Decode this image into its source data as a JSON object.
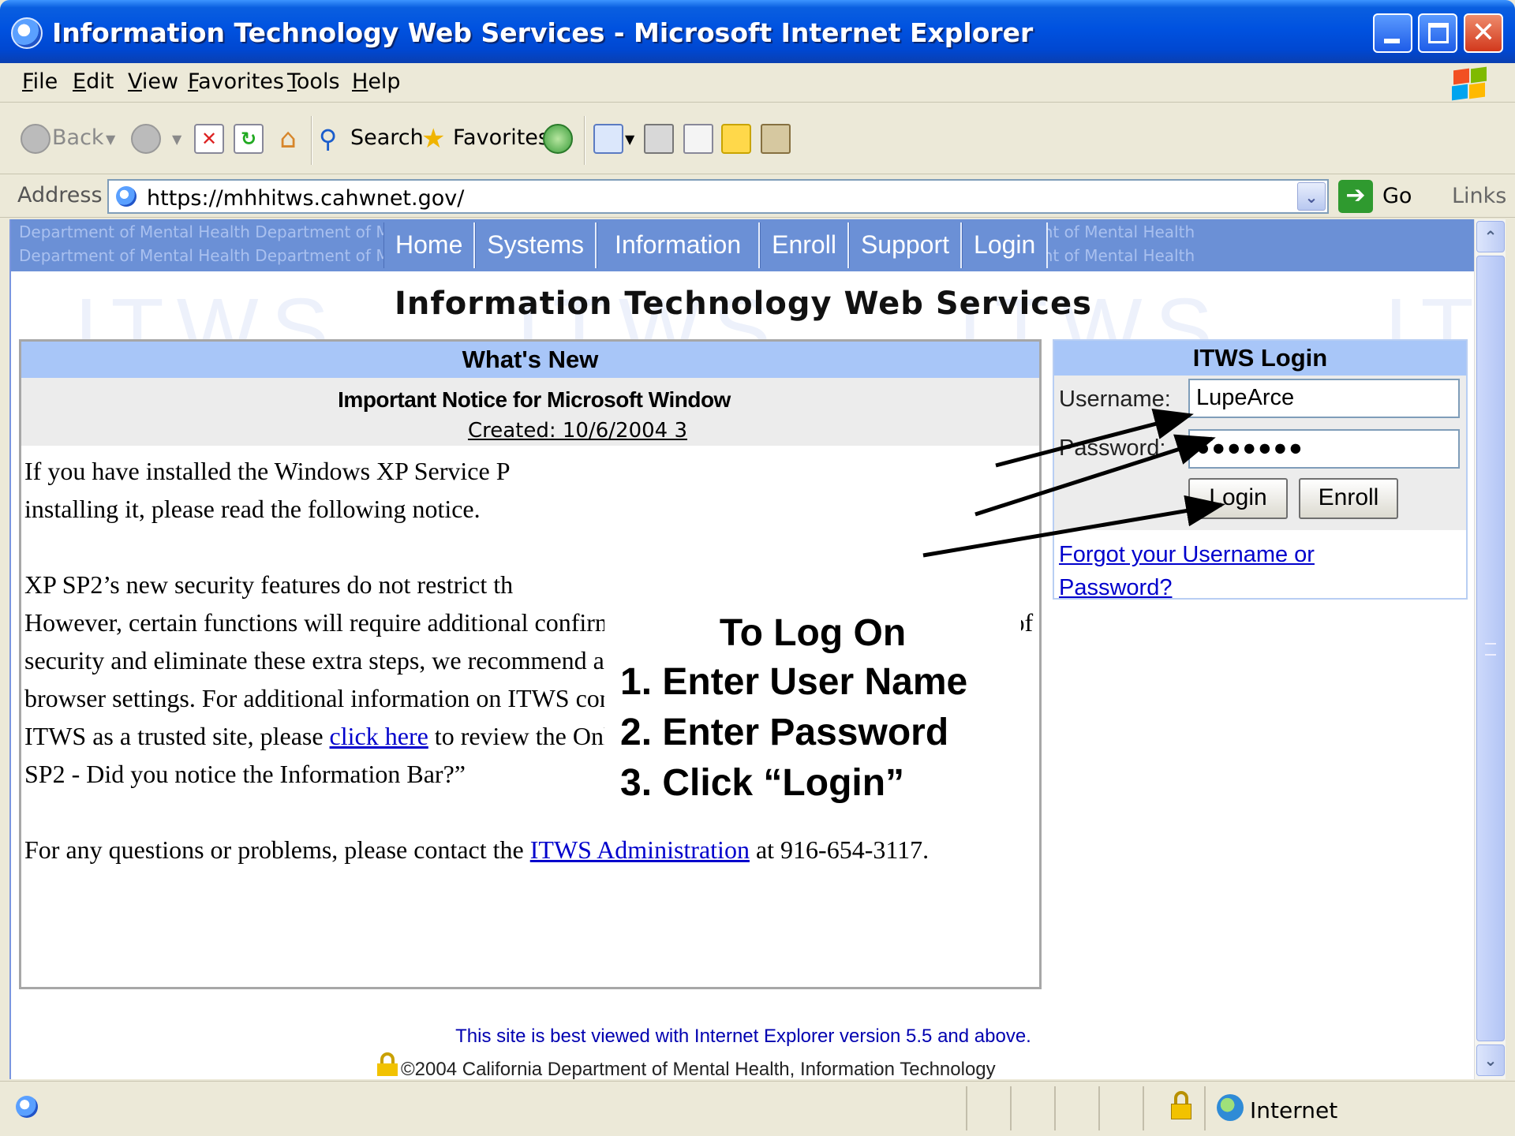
{
  "window": {
    "title": "Information Technology Web Services - Microsoft Internet Explorer"
  },
  "menu": [
    "File",
    "Edit",
    "View",
    "Favorites",
    "Tools",
    "Help"
  ],
  "toolbar": {
    "back": "Back",
    "search": "Search",
    "favorites": "Favorites"
  },
  "address": {
    "label": "Address",
    "url": "https://mhhitws.cahwnet.gov/",
    "go": "Go",
    "links": "Links"
  },
  "site": {
    "nav_bg_text": "Department of Mental Health   Department of Mental Health   Department of Mental Health   Department of Mental Health   Department of Mental Health",
    "nav": [
      "Home",
      "Systems",
      "Information",
      "Enroll",
      "Support",
      "Login"
    ],
    "watermark": "ITWS",
    "title": "Information Technology Web Services"
  },
  "news": {
    "header": "What's New",
    "notice_title": "Important Notice for Microsoft Window",
    "notice_date": "Created: 10/6/2004 3",
    "p1": "If you have installed the Windows XP Service P",
    "p1b": "installing it, please read the following notice.",
    "p2a": "XP SP2’s new security features do not restrict th",
    "p2b": "However, certain functions will require additional confirmation steps.  To maintain the same level of security and eliminate these extra steps, we recommend adding the ITWS as a trusted site in your browser settings. For additional information on ITWS compliance with XP SP2 and on adding the ITWS as a trusted site, please",
    "p2_link": "click here",
    "p2c": " to review the Online Technical Support item called “XP SP2  - Did you notice the Information Bar?”",
    "p3a": "For any questions or problems, please contact the",
    "p3_link": "ITWS Administration",
    "p3b": "at 916-654-3117."
  },
  "login": {
    "header": "ITWS Login",
    "username_label": "Username:",
    "username_value": "LupeArce",
    "password_label": "Password:",
    "password_value": "●●●●●●●",
    "login_button": "Login",
    "enroll_button": "Enroll",
    "forgot_link": "Forgot your Username or Password?"
  },
  "footer": {
    "note": "This site is best viewed with Internet Explorer version 5.5 and above.",
    "copyright": "©2004 California Department of Mental Health, Information Technology"
  },
  "callout": {
    "title": "To Log On",
    "step1": "1. Enter User Name",
    "step2": "2. Enter Password",
    "step3": "3. Click “Login”"
  },
  "status": {
    "zone": "Internet"
  }
}
